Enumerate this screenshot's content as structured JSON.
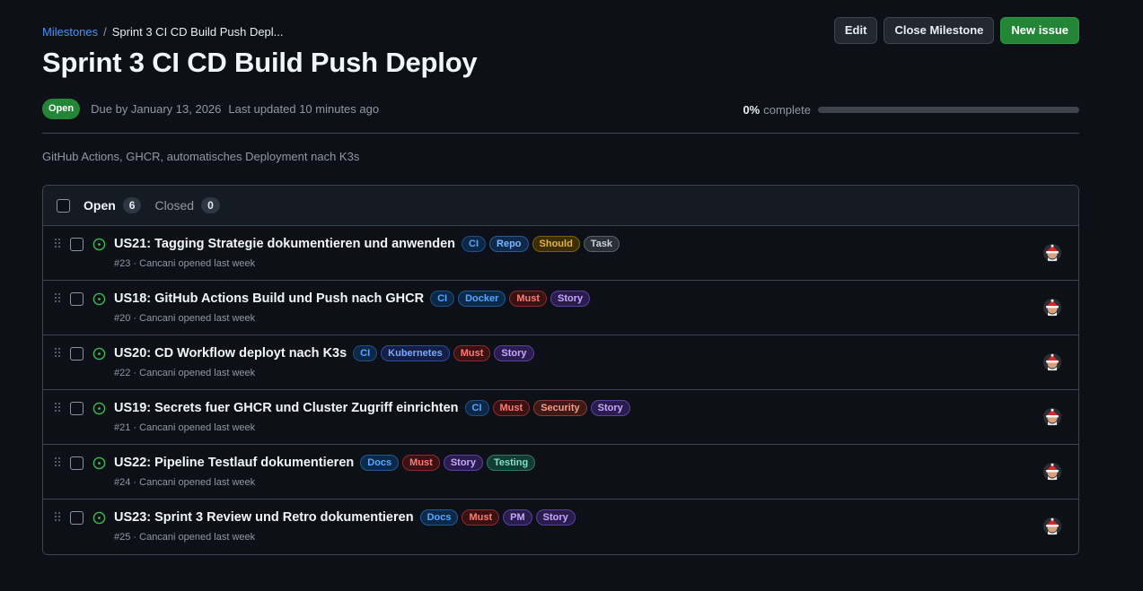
{
  "breadcrumb": {
    "root": "Milestones",
    "current": "Sprint 3 CI CD Build Push Depl..."
  },
  "actions": {
    "edit": "Edit",
    "close": "Close Milestone",
    "new_issue": "New issue"
  },
  "milestone": {
    "title": "Sprint 3 CI CD Build Push Deploy",
    "state": "Open",
    "due": "Due by January 13, 2026",
    "updated": "Last updated 10 minutes ago",
    "progress_pct": "0%",
    "progress_suffix": "complete",
    "progress_fraction": 0,
    "description": "GitHub Actions, GHCR, automatisches Deployment nach K3s"
  },
  "tabs": {
    "open_label": "Open",
    "open_count": "6",
    "closed_label": "Closed",
    "closed_count": "0"
  },
  "issues": [
    {
      "title": "US21: Tagging Strategie dokumentieren und anwenden",
      "sub": "#23 · Cancani opened last week",
      "labels": [
        {
          "text": "CI",
          "fg": "#58a6ff",
          "bg": "#0d2847",
          "bd": "#1f4e85"
        },
        {
          "text": "Repo",
          "fg": "#79b8ff",
          "bg": "#10284a",
          "bd": "#2a5a96"
        },
        {
          "text": "Should",
          "fg": "#e3b341",
          "bg": "#3b2e05",
          "bd": "#7d5f0b"
        },
        {
          "text": "Task",
          "fg": "#c9d1d9",
          "bg": "#2b3036",
          "bd": "#57606a"
        }
      ]
    },
    {
      "title": "US18: GitHub Actions Build und Push nach GHCR",
      "sub": "#20 · Cancani opened last week",
      "labels": [
        {
          "text": "CI",
          "fg": "#58a6ff",
          "bg": "#0d2847",
          "bd": "#1f4e85"
        },
        {
          "text": "Docker",
          "fg": "#58a6ff",
          "bg": "#0b2a4a",
          "bd": "#1f5a96"
        },
        {
          "text": "Must",
          "fg": "#ff7b72",
          "bg": "#3a1214",
          "bd": "#8e2a2d"
        },
        {
          "text": "Story",
          "fg": "#c7a6ff",
          "bg": "#2a1d4d",
          "bd": "#5b3fa3"
        }
      ]
    },
    {
      "title": "US20: CD Workflow deployt nach K3s",
      "sub": "#22 · Cancani opened last week",
      "labels": [
        {
          "text": "CI",
          "fg": "#58a6ff",
          "bg": "#0d2847",
          "bd": "#1f4e85"
        },
        {
          "text": "Kubernetes",
          "fg": "#79a8ff",
          "bg": "#141f45",
          "bd": "#2f4a9a"
        },
        {
          "text": "Must",
          "fg": "#ff7b72",
          "bg": "#3a1214",
          "bd": "#8e2a2d"
        },
        {
          "text": "Story",
          "fg": "#c7a6ff",
          "bg": "#2a1d4d",
          "bd": "#5b3fa3"
        }
      ]
    },
    {
      "title": "US19: Secrets fuer GHCR und Cluster Zugriff einrichten",
      "sub": "#21 · Cancani opened last week",
      "labels": [
        {
          "text": "CI",
          "fg": "#58a6ff",
          "bg": "#0d2847",
          "bd": "#1f4e85"
        },
        {
          "text": "Must",
          "fg": "#ff7b72",
          "bg": "#3a1214",
          "bd": "#8e2a2d"
        },
        {
          "text": "Security",
          "fg": "#ff9b8a",
          "bg": "#3d1a17",
          "bd": "#8a3a30"
        },
        {
          "text": "Story",
          "fg": "#c7a6ff",
          "bg": "#2a1d4d",
          "bd": "#5b3fa3"
        }
      ]
    },
    {
      "title": "US22: Pipeline Testlauf dokumentieren",
      "sub": "#24 · Cancani opened last week",
      "labels": [
        {
          "text": "Docs",
          "fg": "#58a6ff",
          "bg": "#0b2a4a",
          "bd": "#1f5a96"
        },
        {
          "text": "Must",
          "fg": "#ff7b72",
          "bg": "#3a1214",
          "bd": "#8e2a2d"
        },
        {
          "text": "Story",
          "fg": "#c7a6ff",
          "bg": "#2a1d4d",
          "bd": "#5b3fa3"
        },
        {
          "text": "Testing",
          "fg": "#7ee2c7",
          "bg": "#113b33",
          "bd": "#2a7a66"
        }
      ]
    },
    {
      "title": "US23: Sprint 3 Review und Retro dokumentieren",
      "sub": "#25 · Cancani opened last week",
      "labels": [
        {
          "text": "Docs",
          "fg": "#58a6ff",
          "bg": "#0b2a4a",
          "bd": "#1f5a96"
        },
        {
          "text": "Must",
          "fg": "#ff7b72",
          "bg": "#3a1214",
          "bd": "#8e2a2d"
        },
        {
          "text": "PM",
          "fg": "#c7a6ff",
          "bg": "#2a1d4d",
          "bd": "#5b3fa3"
        },
        {
          "text": "Story",
          "fg": "#c7a6ff",
          "bg": "#2a1d4d",
          "bd": "#5b3fa3"
        }
      ]
    }
  ],
  "colors": {
    "accent": "#4493f8",
    "open_green": "#238636",
    "icon_green": "#3fb950"
  }
}
